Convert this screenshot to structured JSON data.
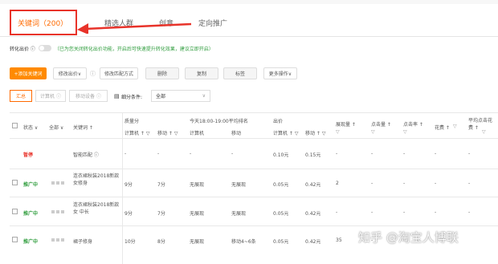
{
  "tabs": [
    "关键词（200）",
    "精选人群",
    "创意",
    "定向推广"
  ],
  "conversion": {
    "label": "转化出价 ⓘ",
    "hint": "（已为您关闭转化出价功能，开启后可快速提升转化效果，建议立即开启）"
  },
  "toolbar": {
    "add_keyword": "+添加关键词",
    "modify_bid": "修改出价∨",
    "modify_match": "修改匹配方式",
    "delete": "删除",
    "copy": "复制",
    "tag": "标签",
    "more": "更多操作∨"
  },
  "filters": {
    "summary": "汇总",
    "computer": "计算机 ⓘ",
    "mobile": "移动设备 ⓘ",
    "segment_label": "细分条件:",
    "segment_value": "全部"
  },
  "headers": {
    "status": "状态 ∨",
    "all": "全部 ∨",
    "keyword": "关键词 ↑",
    "quality": "质量分",
    "today_rank": "今天18:00-19:00平均排名",
    "bid": "出价",
    "impressions": "展现量 ↑",
    "clicks": "点击量 ↑",
    "ctr": "点击率 ↑",
    "cost": "花费 ↑",
    "avg_cpc": "平均点击花费 ↑",
    "sub_computer": "计算机 ↑ ▽",
    "sub_mobile": "移动 ↑ ▽",
    "rank_computer": "计算机",
    "rank_mobile": "移动",
    "filter_icon": "▽"
  },
  "rows": [
    {
      "status": "暂停",
      "status_type": "paused",
      "keyword": "智能匹配 ⓘ",
      "q_pc": "-",
      "q_mobile": "-",
      "rank_pc": "-",
      "rank_mobile": "-",
      "bid_pc": "0.10元",
      "bid_mobile": "0.15元",
      "impressions": "-",
      "clicks": "-",
      "ctr": "-",
      "cost": "-",
      "cpc": "-"
    },
    {
      "status": "推广中",
      "status_type": "on",
      "keyword": "连衣裙秋装2018新款女修身",
      "q_pc": "9分",
      "q_mobile": "7分",
      "rank_pc": "无展现",
      "rank_mobile": "无展现",
      "bid_pc": "0.05元",
      "bid_mobile": "0.42元",
      "impressions": "2",
      "clicks": "-",
      "ctr": "-",
      "cost": "-",
      "cpc": "-"
    },
    {
      "status": "推广中",
      "status_type": "on",
      "keyword": "连衣裙秋装2018新款女 中长",
      "q_pc": "9分",
      "q_mobile": "7分",
      "rank_pc": "无展现",
      "rank_mobile": "无展现",
      "bid_pc": "0.05元",
      "bid_mobile": "0.42元",
      "impressions": "-",
      "clicks": "-",
      "ctr": "-",
      "cost": "-",
      "cpc": "-"
    },
    {
      "status": "推广中",
      "status_type": "on",
      "keyword": "裙子修身",
      "q_pc": "10分",
      "q_mobile": "8分",
      "rank_pc": "无展现",
      "rank_mobile": "移动4~6条",
      "bid_pc": "0.05元",
      "bid_mobile": "0.42元",
      "impressions": "35",
      "clicks": "-",
      "ctr": "-",
      "cost": "-",
      "cpc": "-"
    }
  ],
  "watermark": "知乎 @淘宝人博联",
  "colors": {
    "accent": "#ff6a00",
    "red": "#e8332a",
    "green": "#2e9c3c"
  }
}
